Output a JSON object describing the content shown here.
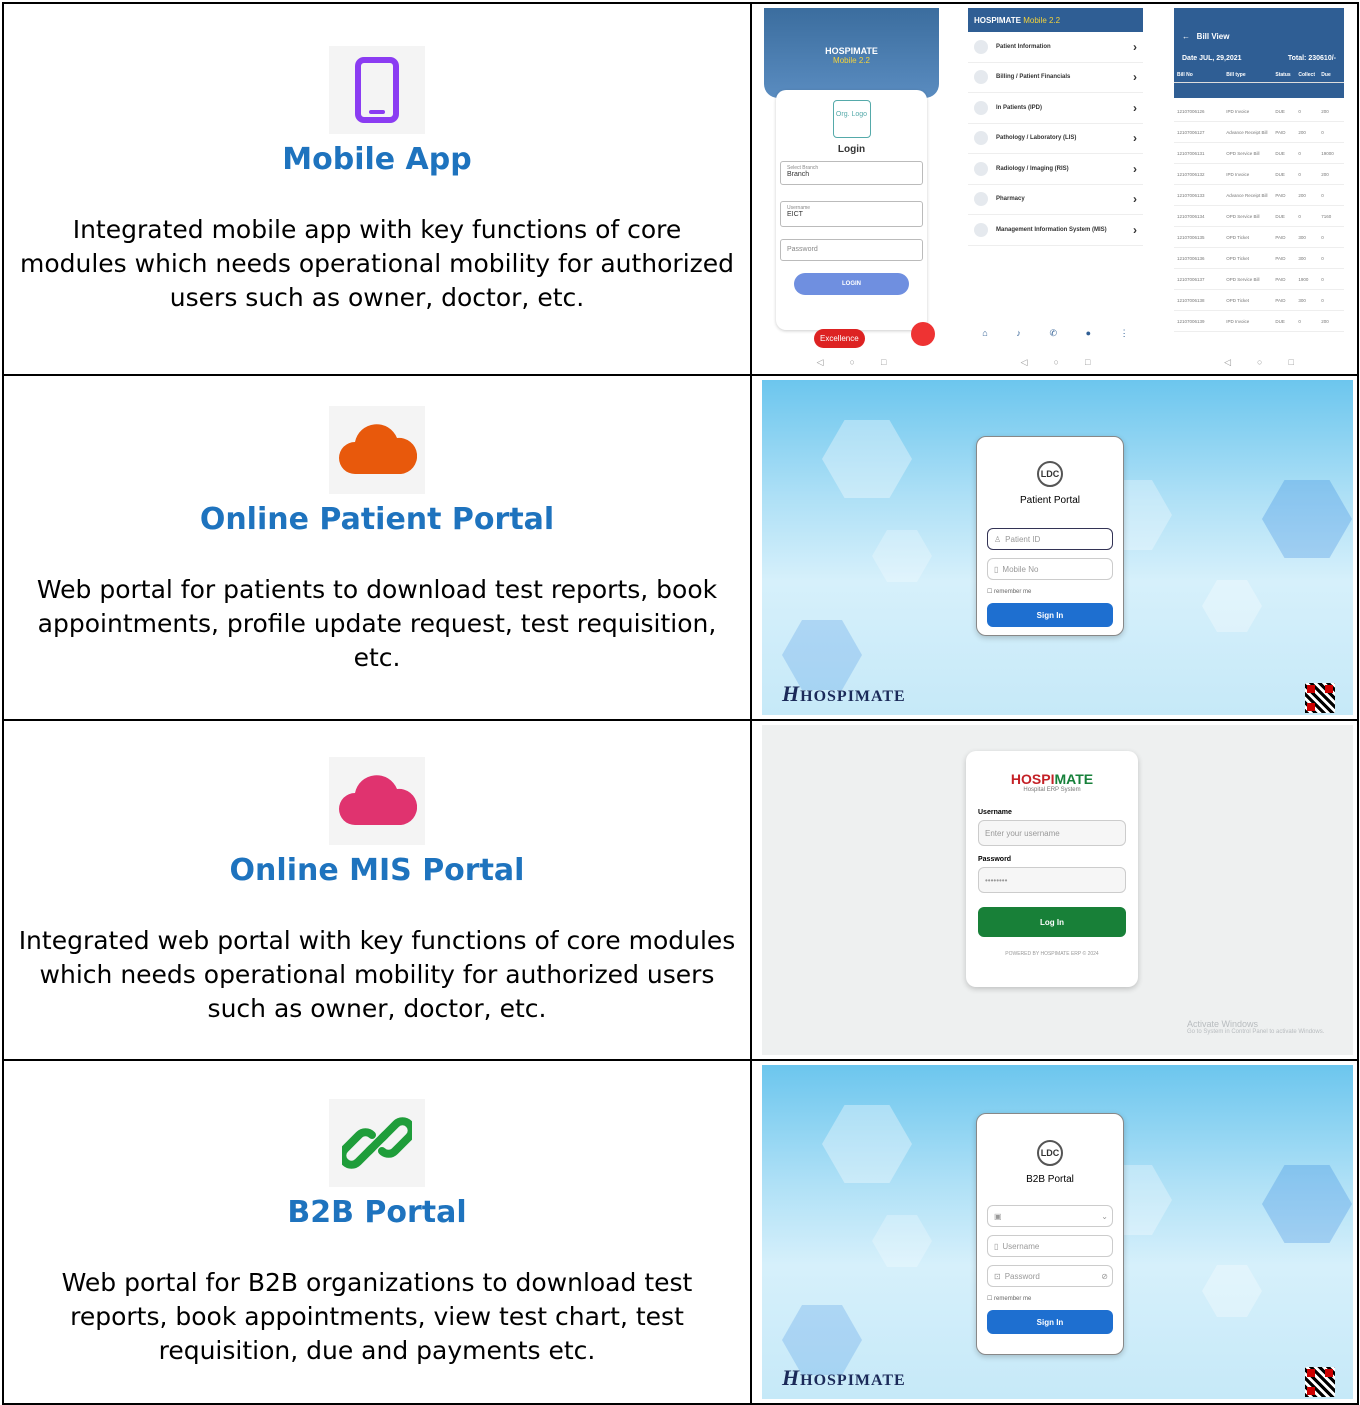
{
  "rows": [
    {
      "title": "Mobile App",
      "description": "Integrated mobile app with key functions of core modules which needs operational mobility for authorized users such as owner, doctor, etc.",
      "icon": "smartphone-icon",
      "icon_color": "#8b3cf2"
    },
    {
      "title": "Online Patient Portal",
      "description": "Web portal for patients to download test reports, book appointments, profile update request, test requisition, etc.",
      "icon": "cloud-icon",
      "icon_color": "#e8590c"
    },
    {
      "title": "Online MIS Portal",
      "description": "Integrated web portal with key functions of core modules which needs operational mobility for authorized users such as owner, doctor, etc.",
      "icon": "cloud-icon",
      "icon_color": "#e0336f"
    },
    {
      "title": "B2B Portal",
      "description": "Web portal for B2B organizations to download test reports, book appointments, view test chart, test requisition, due and payments etc.",
      "icon": "link-icon",
      "icon_color": "#1f9d3a"
    }
  ],
  "mobile_login": {
    "app_name": "HOSPIMATE",
    "version": "Mobile 2.2",
    "org_logo": "Org. Logo",
    "heading": "Login",
    "branch_label": "Select Branch",
    "branch_value": "Branch",
    "username_label": "Username",
    "username_value": "EICT",
    "password_placeholder": "Password",
    "login_button": "LOGIN",
    "badge": "Excellence"
  },
  "mobile_menu": {
    "title": "HOSPIMATE",
    "version": "Mobile 2.2",
    "items": [
      "Patient Information",
      "Billing / Patient Financials",
      "In Patients (IPD)",
      "Pathology / Laboratory (LIS)",
      "Radiology / Imaging (RIS)",
      "Pharmacy",
      "Management Information System (MIS)"
    ],
    "home_label": "Home"
  },
  "mobile_bill": {
    "title": "Bill View",
    "date_label": "Date",
    "date_value": "JUL, 29,2021",
    "total_label": "Total:",
    "total_value": "230610/-",
    "columns": [
      "Bill No",
      "Bill type",
      "Status",
      "Collect",
      "Due"
    ],
    "rows": [
      [
        "12107006126",
        "IPD Invoice",
        "DUE",
        "0",
        "200"
      ],
      [
        "12107006127",
        "Advance Receipt Bill",
        "PAID",
        "200",
        "0"
      ],
      [
        "12107006131",
        "OPD Service Bill",
        "DUE",
        "0",
        "19000"
      ],
      [
        "12107006132",
        "IPD Invoice",
        "DUE",
        "0",
        "200"
      ],
      [
        "12107006133",
        "Advance Receipt Bill",
        "PAID",
        "200",
        "0"
      ],
      [
        "12107006134",
        "OPD Service Bill",
        "DUE",
        "0",
        "7160"
      ],
      [
        "12107006135",
        "OPD Ticket",
        "PAID",
        "300",
        "0"
      ],
      [
        "12107006136",
        "OPD Ticket",
        "PAID",
        "300",
        "0"
      ],
      [
        "12107006137",
        "OPD Service Bill",
        "PAID",
        "1900",
        "0"
      ],
      [
        "12107006138",
        "OPD Ticket",
        "PAID",
        "300",
        "0"
      ],
      [
        "12107006139",
        "IPD Invoice",
        "DUE",
        "0",
        "200"
      ]
    ]
  },
  "patient_portal": {
    "logo": "LDC",
    "title": "Patient Portal",
    "patient_id_placeholder": "Patient ID",
    "mobile_placeholder": "Mobile No",
    "remember": "remember me",
    "sign_in": "Sign In",
    "brand": "HOSPIMATE"
  },
  "mis_portal": {
    "brand_a": "HOSPI",
    "brand_b": "MATE",
    "subtitle": "Hospital ERP System",
    "username_label": "Username",
    "username_placeholder": "Enter your username",
    "password_label": "Password",
    "password_value": "••••••••",
    "login_button": "Log In",
    "footer": "POWERED BY HOSPIMATE ERP © 2024",
    "watermark_title": "Activate Windows",
    "watermark_sub": "Go to System in Control Panel to activate Windows."
  },
  "b2b_portal": {
    "logo": "LDC",
    "title": "B2B Portal",
    "username_placeholder": "Username",
    "password_placeholder": "Password",
    "remember": "remember me",
    "sign_in": "Sign In",
    "brand": "HOSPIMATE"
  }
}
